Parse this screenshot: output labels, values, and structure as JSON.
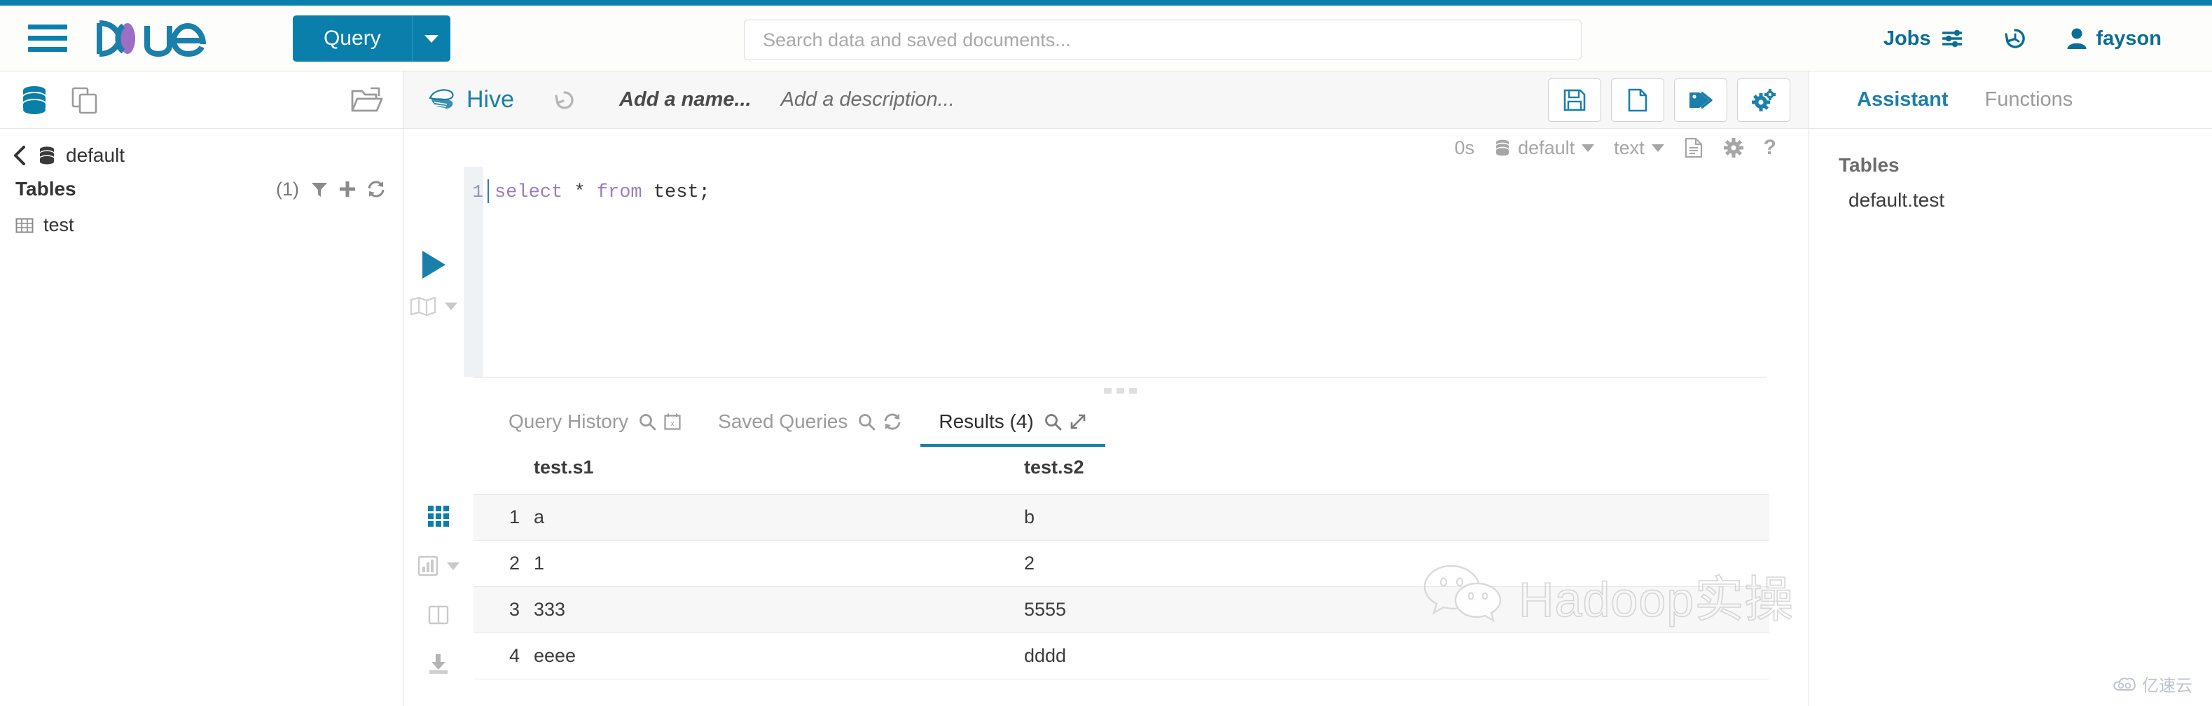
{
  "colors": {
    "accent": "#0b7fab",
    "accent_dark": "#0b6e94",
    "tab_active": "#1b7fab",
    "keyword": "#9a7fc0",
    "muted": "#a6a6a6"
  },
  "header": {
    "menu_icon": "hamburger-icon",
    "logo_text": "Hue",
    "query_button": {
      "label": "Query",
      "caret": "▾"
    },
    "search": {
      "value": "",
      "placeholder": "Search data and saved documents..."
    },
    "jobs": {
      "label": "Jobs",
      "icon": "sliders-icon"
    },
    "history": {
      "icon": "history-icon"
    },
    "user": {
      "label": "fayson",
      "icon": "user-icon"
    }
  },
  "sidebar": {
    "top_icons": [
      "database-icon",
      "documents-icon"
    ],
    "top_right_icon": "open-folder-icon",
    "breadcrumb": {
      "back_icon": "chevron-left-icon",
      "db_icon": "database-icon",
      "label": "default"
    },
    "tables_section": {
      "label": "Tables",
      "count": "(1)",
      "actions": [
        "filter-icon",
        "plus-icon",
        "refresh-icon"
      ]
    },
    "tables": [
      {
        "icon": "table-icon",
        "label": "test"
      }
    ]
  },
  "editor": {
    "dialect": {
      "icon": "hive-icon",
      "label": "Hive"
    },
    "undo_icon": "history-undo-icon",
    "name": {
      "value": "",
      "placeholder": "Add a name..."
    },
    "description": {
      "value": "",
      "placeholder": "Add a description..."
    },
    "buttons": [
      {
        "name": "save-button",
        "icon": "floppy-save-icon"
      },
      {
        "name": "new-document-button",
        "icon": "file-icon"
      },
      {
        "name": "tags-button",
        "icon": "tags-icon"
      },
      {
        "name": "settings-button",
        "icon": "gears-icon"
      }
    ],
    "meta": {
      "duration": "0s",
      "database": "default",
      "format": "text",
      "icons": [
        "document-icon",
        "gear-icon",
        "help-icon"
      ]
    },
    "run_button_icon": "play-icon",
    "book_button_icon": "book-icon",
    "gutter": {
      "line_numbers": [
        "1"
      ]
    },
    "query": {
      "tokens": [
        {
          "text": "select",
          "type": "keyword"
        },
        {
          "text": " ",
          "type": "plain"
        },
        {
          "text": "*",
          "type": "operator"
        },
        {
          "text": " ",
          "type": "plain"
        },
        {
          "text": "from",
          "type": "keyword"
        },
        {
          "text": " ",
          "type": "plain"
        },
        {
          "text": "test;",
          "type": "identifier"
        }
      ],
      "full_text": "select * from test;"
    }
  },
  "results": {
    "tabs": [
      {
        "label": "Query History",
        "icons": [
          "search-icon",
          "calendar-icon"
        ],
        "active": false
      },
      {
        "label": "Saved Queries",
        "icons": [
          "search-icon",
          "refresh-icon"
        ],
        "active": false
      },
      {
        "label": "Results (4)",
        "icons": [
          "search-icon",
          "expand-icon"
        ],
        "active": true
      }
    ],
    "side_icons": [
      {
        "name": "grid-view-icon",
        "active": true
      },
      {
        "name": "chart-view-icon",
        "active": false
      },
      {
        "name": "columns-view-icon",
        "active": false
      },
      {
        "name": "download-icon",
        "active": false
      }
    ],
    "columns": [
      "",
      "test.s1",
      "test.s2"
    ],
    "rows": [
      {
        "num": "1",
        "s1": "a",
        "s2": "b"
      },
      {
        "num": "2",
        "s1": "1",
        "s2": "2"
      },
      {
        "num": "3",
        "s1": "333",
        "s2": "5555"
      },
      {
        "num": "4",
        "s1": "eeee",
        "s2": "dddd"
      }
    ]
  },
  "assistant": {
    "tabs": [
      {
        "label": "Assistant",
        "active": true
      },
      {
        "label": "Functions",
        "active": false
      }
    ],
    "section_label": "Tables",
    "items": [
      "default.test"
    ]
  },
  "watermark": {
    "text": "Hadoop实操",
    "icon": "wechat-icon"
  },
  "brand_badge": {
    "text": "亿速云",
    "icon": "cloud-icon"
  }
}
